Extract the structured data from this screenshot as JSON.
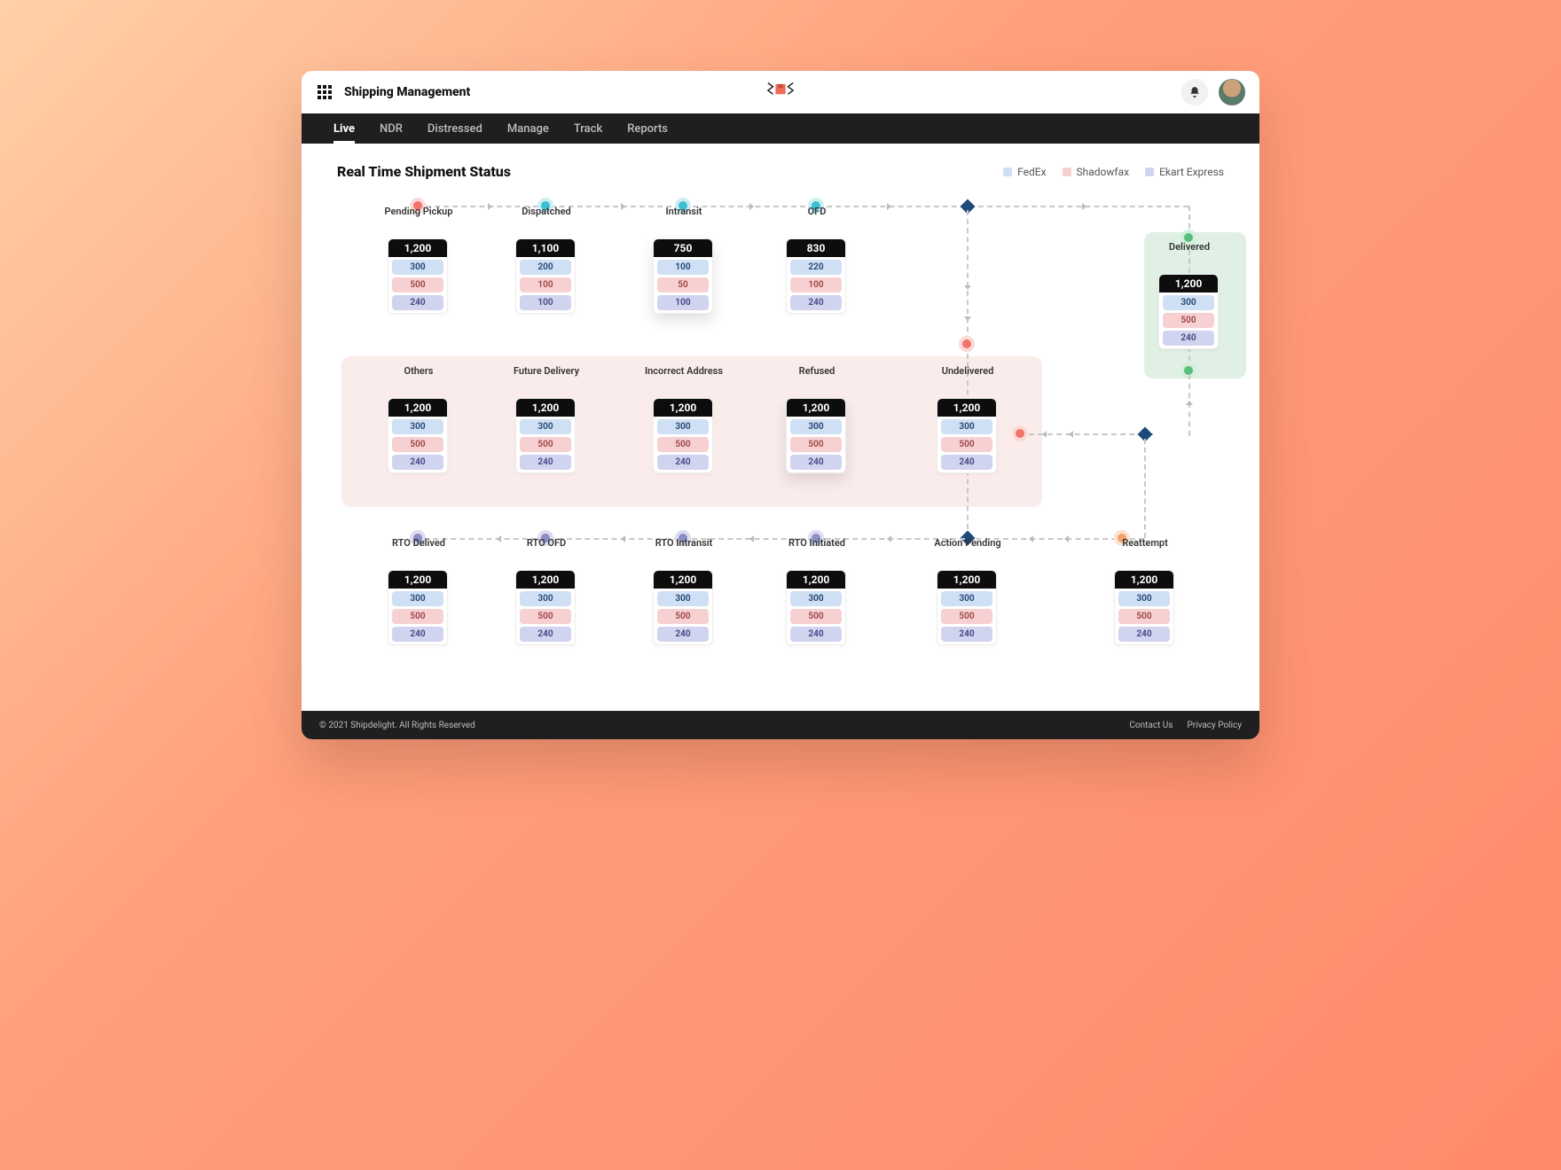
{
  "header": {
    "title": "Shipping Management"
  },
  "nav": {
    "items": [
      "Live",
      "NDR",
      "Distressed",
      "Manage",
      "Track",
      "Reports"
    ],
    "active": 0
  },
  "page": {
    "title": "Real Time Shipment Status"
  },
  "legend": [
    {
      "label": "FedEx",
      "color": "#cfe0f4"
    },
    {
      "label": "Shadowfax",
      "color": "#f7d1d1"
    },
    {
      "label": "Ekart Express",
      "color": "#d0d4ee"
    }
  ],
  "cards": {
    "pending_pickup": {
      "label": "Pending Pickup",
      "total": "1,200",
      "vals": [
        "300",
        "500",
        "240"
      ]
    },
    "dispatched": {
      "label": "Dispatched",
      "total": "1,100",
      "vals": [
        "200",
        "100",
        "100"
      ]
    },
    "intransit": {
      "label": "Intransit",
      "total": "750",
      "vals": [
        "100",
        "50",
        "100"
      ]
    },
    "ofd": {
      "label": "OFD",
      "total": "830",
      "vals": [
        "220",
        "100",
        "240"
      ]
    },
    "delivered": {
      "label": "Delivered",
      "total": "1,200",
      "vals": [
        "300",
        "500",
        "240"
      ]
    },
    "others": {
      "label": "Others",
      "total": "1,200",
      "vals": [
        "300",
        "500",
        "240"
      ]
    },
    "future_delivery": {
      "label": "Future Delivery",
      "total": "1,200",
      "vals": [
        "300",
        "500",
        "240"
      ]
    },
    "incorrect_addr": {
      "label": "Incorrect Address",
      "total": "1,200",
      "vals": [
        "300",
        "500",
        "240"
      ]
    },
    "refused": {
      "label": "Refused",
      "total": "1,200",
      "vals": [
        "300",
        "500",
        "240"
      ]
    },
    "undelivered": {
      "label": "Undelivered",
      "total": "1,200",
      "vals": [
        "300",
        "500",
        "240"
      ]
    },
    "rto_delivered": {
      "label": "RTO Delived",
      "total": "1,200",
      "vals": [
        "300",
        "500",
        "240"
      ]
    },
    "rto_ofd": {
      "label": "RTO OFD",
      "total": "1,200",
      "vals": [
        "300",
        "500",
        "240"
      ]
    },
    "rto_intransit": {
      "label": "RTO Intransit",
      "total": "1,200",
      "vals": [
        "300",
        "500",
        "240"
      ]
    },
    "rto_initiated": {
      "label": "RTO Initiated",
      "total": "1,200",
      "vals": [
        "300",
        "500",
        "240"
      ]
    },
    "action_pending": {
      "label": "Action Pending",
      "total": "1,200",
      "vals": [
        "300",
        "500",
        "240"
      ]
    },
    "reattempt": {
      "label": "Reattempt",
      "total": "1,200",
      "vals": [
        "300",
        "500",
        "240"
      ]
    }
  },
  "footer": {
    "copyright": "© 2021 Shipdelight. All Rights Reserved",
    "links": [
      "Contact Us",
      "Privacy Policy"
    ]
  }
}
